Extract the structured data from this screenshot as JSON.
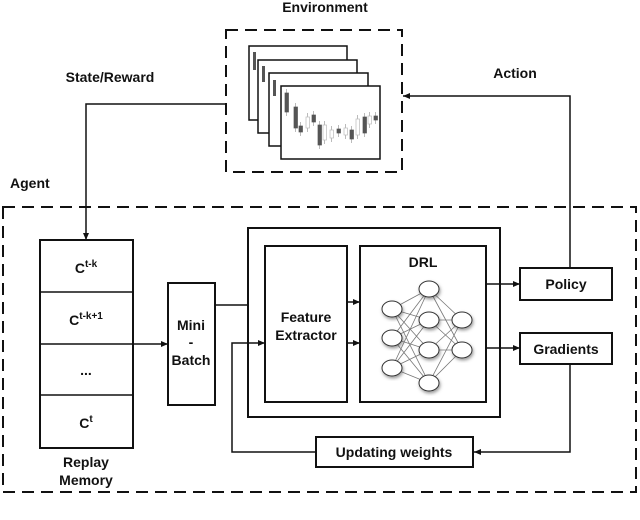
{
  "environment": {
    "label": "Environment"
  },
  "flows": {
    "state_reward": "State/Reward",
    "action": "Action"
  },
  "agent": {
    "label": "Agent",
    "replay_memory": {
      "cells": [
        {
          "base": "C",
          "sup": "t-k"
        },
        {
          "base": "C",
          "sup": "t-k+1"
        },
        {
          "base": "...",
          "sup": ""
        },
        {
          "base": "C",
          "sup": "t"
        }
      ],
      "label_line1": "Replay",
      "label_line2": "Memory"
    },
    "mini_batch": {
      "line1": "Mini",
      "line2": "-",
      "line3": "Batch"
    },
    "feature_extractor": {
      "line1": "Feature",
      "line2": "Extractor"
    },
    "drl": {
      "label": "DRL"
    },
    "policy": "Policy",
    "gradients": "Gradients",
    "updating_weights": "Updating weights"
  }
}
